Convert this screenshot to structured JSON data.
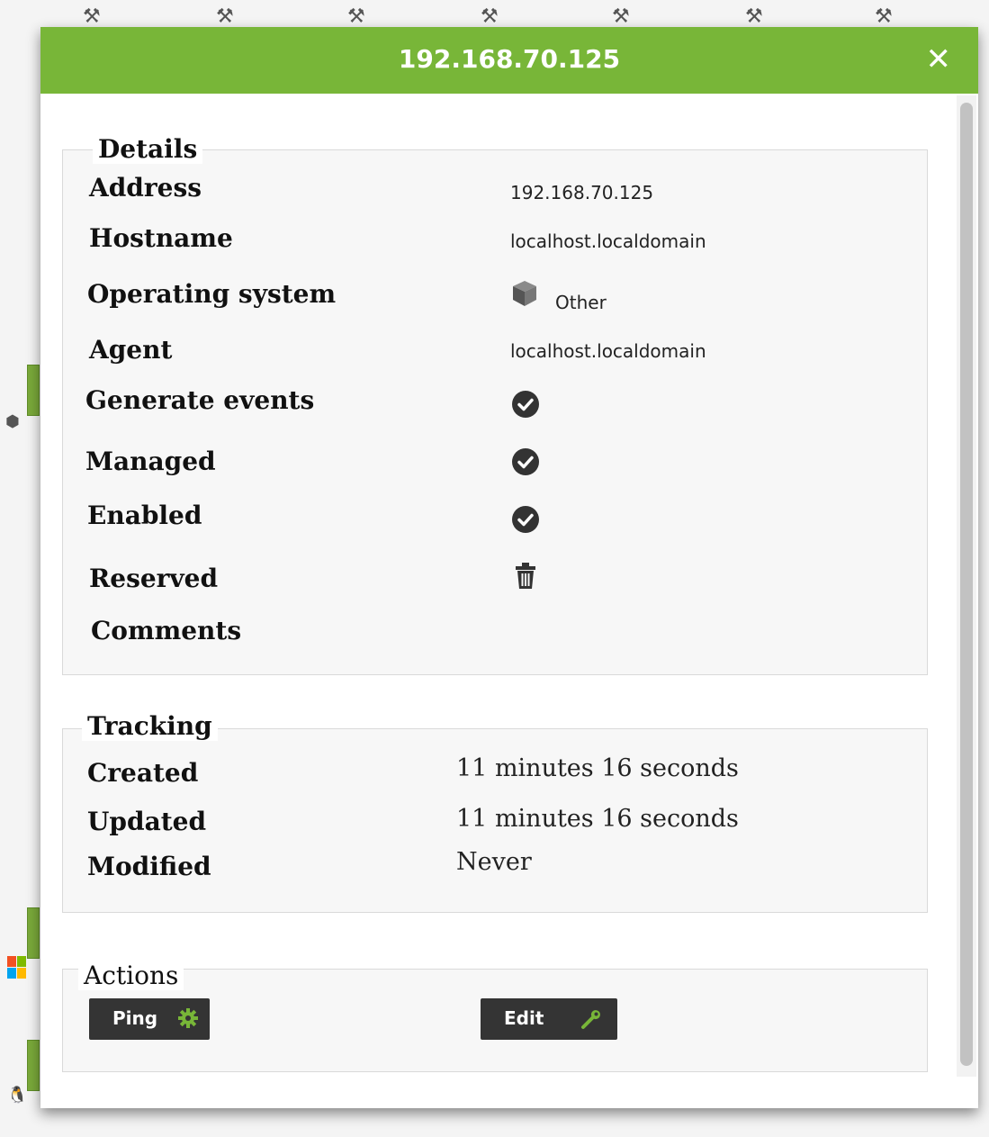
{
  "dialog": {
    "title": "192.168.70.125",
    "close_icon": "close-icon"
  },
  "details": {
    "legend": "Details",
    "rows": {
      "address": {
        "label": "Address",
        "value": "192.168.70.125"
      },
      "hostname": {
        "label": "Hostname",
        "value": "localhost.localdomain"
      },
      "os": {
        "label": "Operating system",
        "value": "Other",
        "icon": "cube-icon"
      },
      "agent": {
        "label": "Agent",
        "value": "localhost.localdomain"
      },
      "generate_events": {
        "label": "Generate events",
        "icon": "check-circle-icon"
      },
      "managed": {
        "label": "Managed",
        "icon": "check-circle-icon"
      },
      "enabled": {
        "label": "Enabled",
        "icon": "check-circle-icon"
      },
      "reserved": {
        "label": "Reserved",
        "icon": "trash-icon"
      },
      "comments": {
        "label": "Comments"
      }
    }
  },
  "tracking": {
    "legend": "Tracking",
    "rows": {
      "created": {
        "label": "Created",
        "value": "11 minutes 16 seconds"
      },
      "updated": {
        "label": "Updated",
        "value": "11 minutes 16 seconds"
      },
      "modified": {
        "label": "Modified",
        "value": "Never"
      }
    }
  },
  "actions": {
    "legend": "Actions",
    "ping_label": "Ping",
    "ping_icon": "gear-icon",
    "edit_label": "Edit",
    "edit_icon": "wrench-icon"
  },
  "colors": {
    "header": "#78b638",
    "accent_green": "#78b638",
    "button_bg": "#343434"
  }
}
